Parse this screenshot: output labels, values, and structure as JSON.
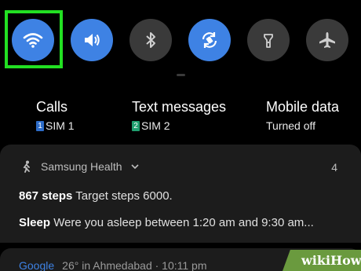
{
  "quick_settings": {
    "tiles": [
      {
        "name": "wifi",
        "icon": "wifi-icon",
        "state": "on",
        "highlighted": true
      },
      {
        "name": "sound",
        "icon": "speaker-icon",
        "state": "on"
      },
      {
        "name": "bluetooth",
        "icon": "bluetooth-icon",
        "state": "off"
      },
      {
        "name": "auto-rotate",
        "icon": "rotate-icon",
        "state": "on"
      },
      {
        "name": "flashlight",
        "icon": "flashlight-icon",
        "state": "off"
      },
      {
        "name": "airplane-mode",
        "icon": "airplane-icon",
        "state": "off"
      }
    ],
    "colors": {
      "on": "#3e82e4",
      "off": "#3a3a3a",
      "highlight": "#22e022"
    }
  },
  "sim_settings": {
    "calls": {
      "title": "Calls",
      "badge": "1",
      "sub": "SIM 1"
    },
    "texts": {
      "title": "Text messages",
      "badge": "2",
      "sub": "SIM 2"
    },
    "data": {
      "title": "Mobile data",
      "sub": "Turned off"
    }
  },
  "notification": {
    "app": "Samsung Health",
    "count": "4",
    "line1": {
      "bold": "867 steps",
      "text": " Target steps 6000."
    },
    "line2": {
      "bold": "Sleep",
      "text": " Were you asleep between 1:20 am and 9:30 am..."
    }
  },
  "notification2": {
    "app": "Google",
    "text": "26° in Ahmedabad · 10:11 pm"
  },
  "watermark": {
    "text": "wikiHow"
  }
}
